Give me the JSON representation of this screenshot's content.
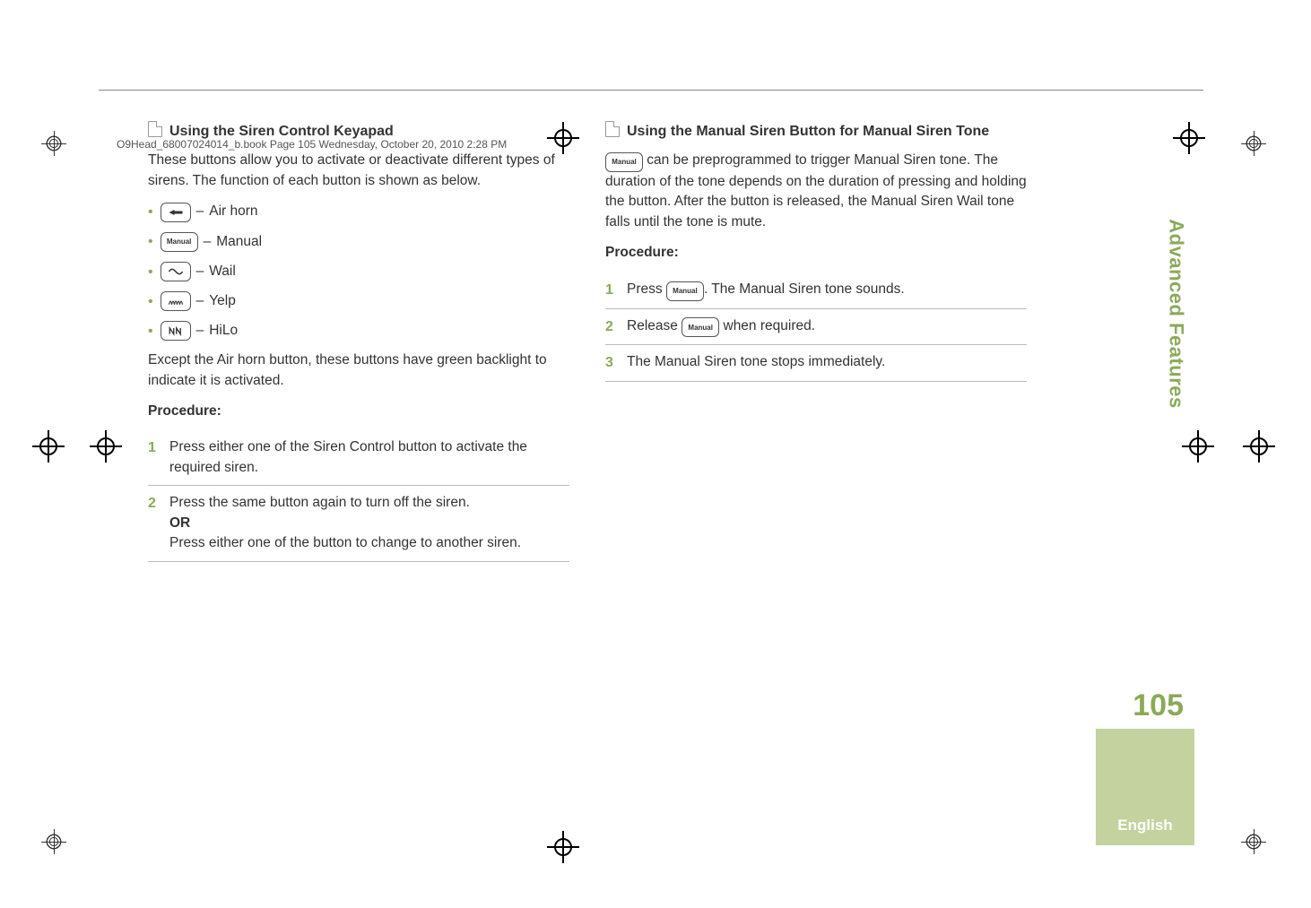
{
  "header": {
    "running_head": "O9Head_68007024014_b.book  Page 105  Wednesday, October 20, 2010  2:28 PM"
  },
  "left": {
    "heading": "Using the Siren Control Keyapad",
    "intro": "These buttons allow you to activate or deactivate different types of sirens. The function of each button is shown as below.",
    "buttons": {
      "airhorn": {
        "dash": "–",
        "label": "Air horn"
      },
      "manual": {
        "key_text": "Manual",
        "dash": "–",
        "label": "Manual"
      },
      "wail": {
        "dash": "–",
        "label": "Wail"
      },
      "yelp": {
        "dash": "–",
        "label": "Yelp"
      },
      "hilo": {
        "dash": "–",
        "label": "HiLo"
      }
    },
    "note": "Except the Air horn button, these buttons have green backlight to indicate it is activated.",
    "procedure_label": "Procedure:",
    "steps": {
      "s1": {
        "num": "1",
        "text": "Press either one of the Siren Control button to activate the required siren."
      },
      "s2": {
        "num": "2",
        "text_a": "Press the same button again to turn off the siren.",
        "or": "OR",
        "text_b": "Press either one of the button to change to another siren."
      }
    }
  },
  "right": {
    "heading": "Using the Manual Siren Button for Manual Siren Tone",
    "key_text": "Manual",
    "intro_a": " can be preprogrammed to trigger Manual Siren tone. The duration of the tone depends on the duration of pressing and holding the button. After the button is released, the Manual Siren Wail tone falls until the tone is mute.",
    "procedure_label": "Procedure:",
    "steps": {
      "s1": {
        "num": "1",
        "text_a": "Press ",
        "text_b": ". The Manual Siren tone sounds."
      },
      "s2": {
        "num": "2",
        "text_a": "Release ",
        "text_b": " when required."
      },
      "s3": {
        "num": "3",
        "text": "The Manual Siren tone stops immediately."
      }
    }
  },
  "side": {
    "section_label": "Advanced Features",
    "page_number": "105",
    "language": "English"
  }
}
